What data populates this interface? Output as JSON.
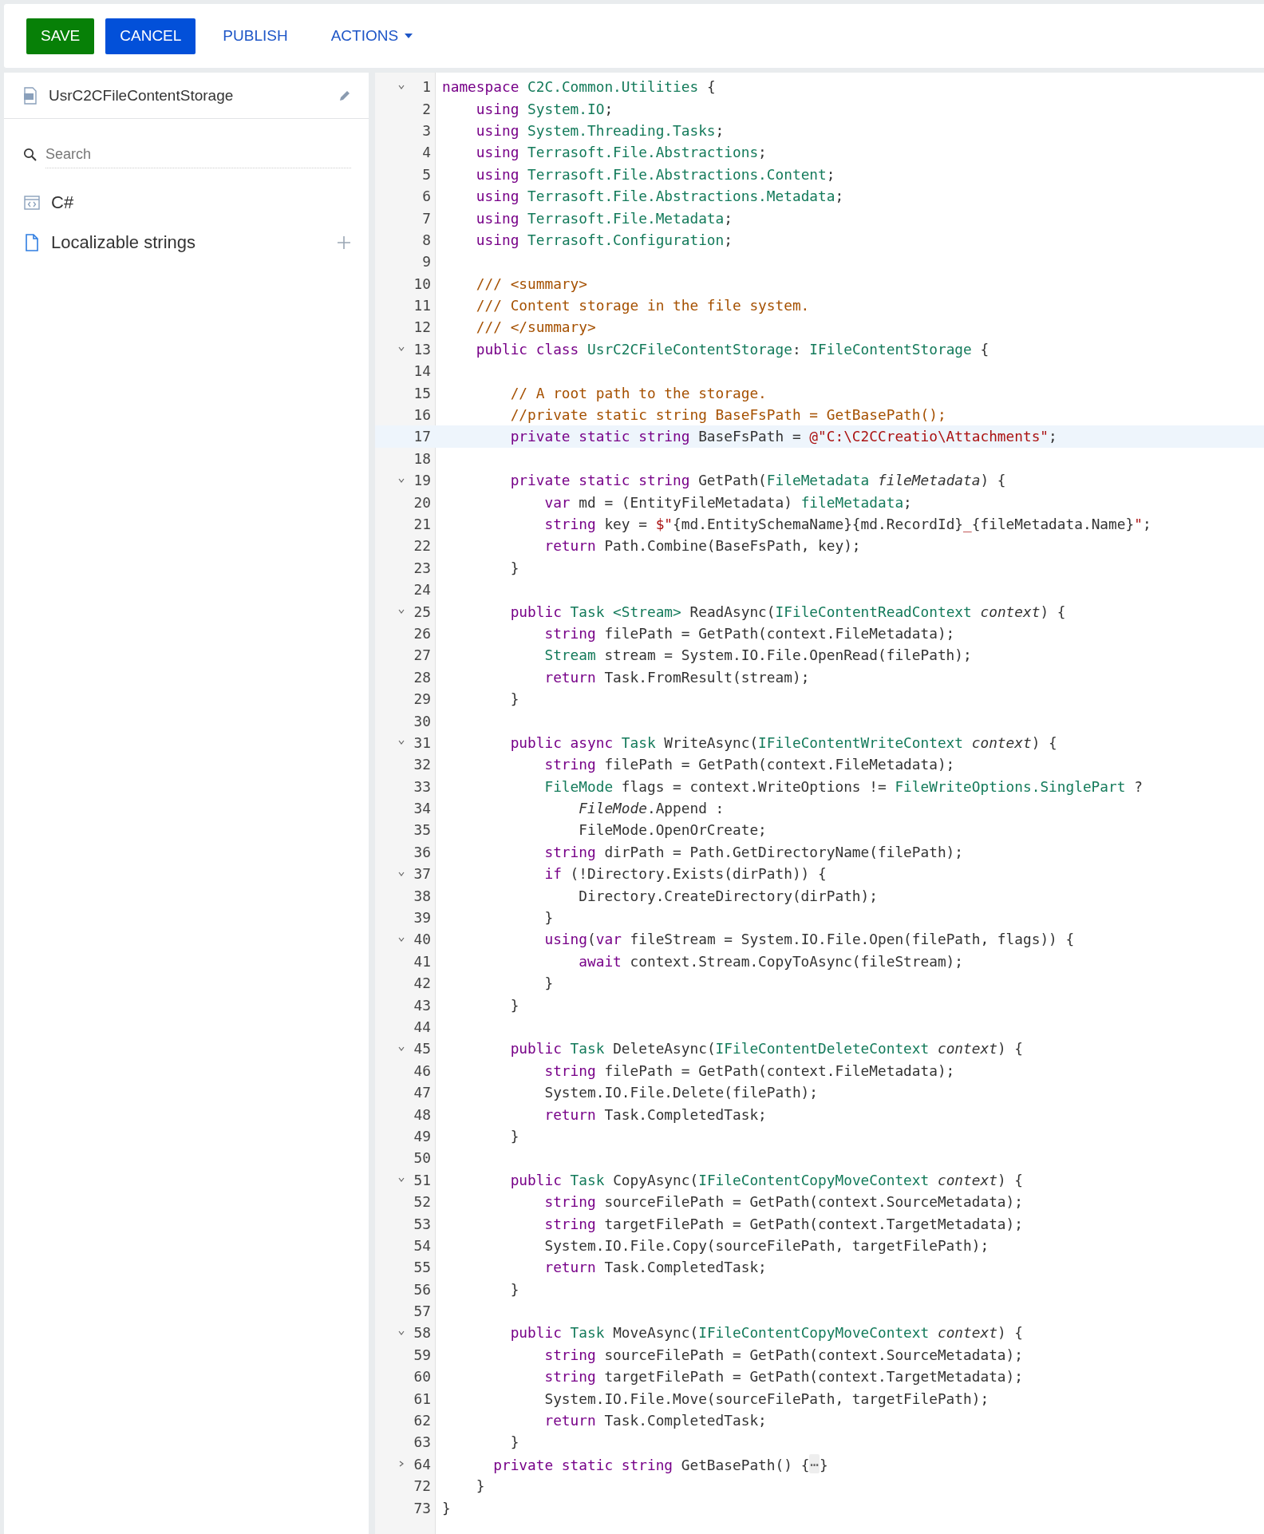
{
  "toolbar": {
    "buttons": [
      {
        "label": "SAVE",
        "kind": "success"
      },
      {
        "label": "CANCEL",
        "kind": "primary"
      },
      {
        "label": "PUBLISH",
        "kind": "link"
      },
      {
        "label": "ACTIONS",
        "kind": "menu"
      }
    ]
  },
  "sidebar": {
    "title": "UsrC2CFileContentStorage",
    "search": {
      "placeholder": "Search"
    },
    "items": [
      {
        "label": "C#",
        "kind": "source"
      },
      {
        "label": "Localizable strings",
        "kind": "strings"
      }
    ]
  },
  "editor": {
    "lines": [
      {
        "number": "1",
        "current": false,
        "expanded": true,
        "tokens": [
          {
            "text": "namespace ",
            "kind": "keyword"
          },
          {
            "text": "C2C.Common.Utilities",
            "kind": "type"
          },
          {
            "text": " {",
            "kind": "plain"
          }
        ]
      },
      {
        "number": "2",
        "current": false,
        "tokens": [
          {
            "text": "    using ",
            "kind": "keyword"
          },
          {
            "text": "System.IO",
            "kind": "type"
          },
          {
            "text": ";",
            "kind": "plain"
          }
        ]
      },
      {
        "number": "3",
        "current": false,
        "tokens": [
          {
            "text": "    using ",
            "kind": "keyword"
          },
          {
            "text": "System.Threading.Tasks",
            "kind": "type"
          },
          {
            "text": ";",
            "kind": "plain"
          }
        ]
      },
      {
        "number": "4",
        "current": false,
        "tokens": [
          {
            "text": "    using ",
            "kind": "keyword"
          },
          {
            "text": "Terrasoft.File.Abstractions",
            "kind": "type"
          },
          {
            "text": ";",
            "kind": "plain"
          }
        ]
      },
      {
        "number": "5",
        "current": false,
        "tokens": [
          {
            "text": "    using ",
            "kind": "keyword"
          },
          {
            "text": "Terrasoft.File.Abstractions.Content",
            "kind": "type"
          },
          {
            "text": ";",
            "kind": "plain"
          }
        ]
      },
      {
        "number": "6",
        "current": false,
        "tokens": [
          {
            "text": "    using ",
            "kind": "keyword"
          },
          {
            "text": "Terrasoft.File.Abstractions.Metadata",
            "kind": "type"
          },
          {
            "text": ";",
            "kind": "plain"
          }
        ]
      },
      {
        "number": "7",
        "current": false,
        "tokens": [
          {
            "text": "    using ",
            "kind": "keyword"
          },
          {
            "text": "Terrasoft.File.Metadata",
            "kind": "type"
          },
          {
            "text": ";",
            "kind": "plain"
          }
        ]
      },
      {
        "number": "8",
        "current": false,
        "tokens": [
          {
            "text": "    using ",
            "kind": "keyword"
          },
          {
            "text": "Terrasoft.Configuration",
            "kind": "type"
          },
          {
            "text": ";",
            "kind": "plain"
          }
        ]
      },
      {
        "number": "9",
        "current": false
      },
      {
        "number": "10",
        "current": false,
        "tokens": [
          {
            "text": "    /// <summary>",
            "kind": "comment"
          }
        ]
      },
      {
        "number": "11",
        "current": false,
        "tokens": [
          {
            "text": "    /// Content storage in the file system.",
            "kind": "comment"
          }
        ]
      },
      {
        "number": "12",
        "current": false,
        "tokens": [
          {
            "text": "    /// </summary>",
            "kind": "comment"
          }
        ]
      },
      {
        "number": "13",
        "current": false,
        "expanded": true,
        "tokens": [
          {
            "text": "    public class ",
            "kind": "keyword"
          },
          {
            "text": "UsrC2CFileContentStorage",
            "kind": "type"
          },
          {
            "text": ": ",
            "kind": "plain"
          },
          {
            "text": "IFileContentStorage",
            "kind": "type"
          },
          {
            "text": " {",
            "kind": "plain"
          }
        ]
      },
      {
        "number": "14",
        "current": false
      },
      {
        "number": "15",
        "current": false,
        "tokens": [
          {
            "text": "        // A root path to the storage.",
            "kind": "comment"
          }
        ]
      },
      {
        "number": "16",
        "current": false,
        "tokens": [
          {
            "text": "        //private static string BaseFsPath = GetBasePath();",
            "kind": "comment"
          }
        ]
      },
      {
        "number": "17",
        "current": true,
        "tokens": [
          {
            "text": "        private static string",
            "kind": "keyword"
          },
          {
            "text": " BaseFsPath = ",
            "kind": "plain"
          },
          {
            "text": "@\"C:\\C2CCreatio\\Attachments\"",
            "kind": "string"
          },
          {
            "text": ";",
            "kind": "plain"
          }
        ]
      },
      {
        "number": "18",
        "current": false
      },
      {
        "number": "19",
        "current": false,
        "expanded": true,
        "tokens": [
          {
            "text": "        private static string",
            "kind": "keyword"
          },
          {
            "text": " GetPath(",
            "kind": "plain"
          },
          {
            "text": "FileMetadata",
            "kind": "type"
          },
          {
            "text": " fileMetadata",
            "kind": "param"
          },
          {
            "text": ") {",
            "kind": "plain"
          }
        ]
      },
      {
        "number": "20",
        "current": false,
        "tokens": [
          {
            "text": "            var",
            "kind": "keyword"
          },
          {
            "text": " md = (EntityFileMetadata) ",
            "kind": "plain"
          },
          {
            "text": "fileMetadata",
            "kind": "type"
          },
          {
            "text": ";",
            "kind": "plain"
          }
        ]
      },
      {
        "number": "21",
        "current": false,
        "tokens": [
          {
            "text": "            string",
            "kind": "keyword"
          },
          {
            "text": " key = ",
            "kind": "plain"
          },
          {
            "text": "$\"",
            "kind": "string"
          },
          {
            "text": "{md.EntitySchemaName}{md.RecordId}",
            "kind": "plain"
          },
          {
            "text": "_",
            "kind": "string"
          },
          {
            "text": "{fileMetadata.Name}",
            "kind": "plain"
          },
          {
            "text": "\"",
            "kind": "string"
          },
          {
            "text": ";",
            "kind": "plain"
          }
        ]
      },
      {
        "number": "22",
        "current": false,
        "tokens": [
          {
            "text": "            return",
            "kind": "keyword"
          },
          {
            "text": " Path.Combine(BaseFsPath, key);",
            "kind": "plain"
          }
        ]
      },
      {
        "number": "23",
        "current": false,
        "tokens": [
          {
            "text": "        }",
            "kind": "plain"
          }
        ]
      },
      {
        "number": "24",
        "current": false
      },
      {
        "number": "25",
        "current": false,
        "expanded": true,
        "tokens": [
          {
            "text": "        public ",
            "kind": "keyword"
          },
          {
            "text": "Task <Stream>",
            "kind": "type"
          },
          {
            "text": " ReadAsync(",
            "kind": "plain"
          },
          {
            "text": "IFileContentReadContext",
            "kind": "type"
          },
          {
            "text": " context",
            "kind": "param"
          },
          {
            "text": ") {",
            "kind": "plain"
          }
        ]
      },
      {
        "number": "26",
        "current": false,
        "tokens": [
          {
            "text": "            string",
            "kind": "keyword"
          },
          {
            "text": " filePath = GetPath(context.FileMetadata);",
            "kind": "plain"
          }
        ]
      },
      {
        "number": "27",
        "current": false,
        "tokens": [
          {
            "text": "            Stream",
            "kind": "type"
          },
          {
            "text": " stream = System.IO.File.OpenRead(filePath);",
            "kind": "plain"
          }
        ]
      },
      {
        "number": "28",
        "current": false,
        "tokens": [
          {
            "text": "            return",
            "kind": "keyword"
          },
          {
            "text": " Task.FromResult(stream);",
            "kind": "plain"
          }
        ]
      },
      {
        "number": "29",
        "current": false,
        "tokens": [
          {
            "text": "        }",
            "kind": "plain"
          }
        ]
      },
      {
        "number": "30",
        "current": false
      },
      {
        "number": "31",
        "current": false,
        "expanded": true,
        "tokens": [
          {
            "text": "        public async ",
            "kind": "keyword"
          },
          {
            "text": "Task",
            "kind": "type"
          },
          {
            "text": " WriteAsync(",
            "kind": "plain"
          },
          {
            "text": "IFileContentWriteContext",
            "kind": "type"
          },
          {
            "text": " context",
            "kind": "param"
          },
          {
            "text": ") {",
            "kind": "plain"
          }
        ]
      },
      {
        "number": "32",
        "current": false,
        "tokens": [
          {
            "text": "            string",
            "kind": "keyword"
          },
          {
            "text": " filePath = GetPath(context.FileMetadata);",
            "kind": "plain"
          }
        ]
      },
      {
        "number": "33",
        "current": false,
        "tokens": [
          {
            "text": "            FileMode",
            "kind": "type"
          },
          {
            "text": " flags = context.WriteOptions != ",
            "kind": "plain"
          },
          {
            "text": "FileWriteOptions.SinglePart",
            "kind": "type"
          },
          {
            "text": " ?",
            "kind": "plain"
          }
        ]
      },
      {
        "number": "34",
        "current": false,
        "tokens": [
          {
            "text": "                FileMode",
            "kind": "param"
          },
          {
            "text": ".Append :",
            "kind": "plain"
          }
        ]
      },
      {
        "number": "35",
        "current": false,
        "tokens": [
          {
            "text": "                FileMode.OpenOrCreate;",
            "kind": "plain"
          }
        ]
      },
      {
        "number": "36",
        "current": false,
        "tokens": [
          {
            "text": "            string",
            "kind": "keyword"
          },
          {
            "text": " dirPath = Path.GetDirectoryName(filePath);",
            "kind": "plain"
          }
        ]
      },
      {
        "number": "37",
        "current": false,
        "expanded": true,
        "tokens": [
          {
            "text": "            if",
            "kind": "keyword"
          },
          {
            "text": " (!Directory.Exists(dirPath)) {",
            "kind": "plain"
          }
        ]
      },
      {
        "number": "38",
        "current": false,
        "tokens": [
          {
            "text": "                Directory.CreateDirectory(dirPath);",
            "kind": "plain"
          }
        ]
      },
      {
        "number": "39",
        "current": false,
        "tokens": [
          {
            "text": "            }",
            "kind": "plain"
          }
        ]
      },
      {
        "number": "40",
        "current": false,
        "expanded": true,
        "tokens": [
          {
            "text": "            using",
            "kind": "keyword"
          },
          {
            "text": "(",
            "kind": "plain"
          },
          {
            "text": "var",
            "kind": "keyword"
          },
          {
            "text": " fileStream = System.IO.File.Open(filePath, flags)) {",
            "kind": "plain"
          }
        ]
      },
      {
        "number": "41",
        "current": false,
        "tokens": [
          {
            "text": "                await",
            "kind": "keyword"
          },
          {
            "text": " context.Stream.CopyToAsync(fileStream);",
            "kind": "plain"
          }
        ]
      },
      {
        "number": "42",
        "current": false,
        "tokens": [
          {
            "text": "            }",
            "kind": "plain"
          }
        ]
      },
      {
        "number": "43",
        "current": false,
        "tokens": [
          {
            "text": "        }",
            "kind": "plain"
          }
        ]
      },
      {
        "number": "44",
        "current": false
      },
      {
        "number": "45",
        "current": false,
        "expanded": true,
        "tokens": [
          {
            "text": "        public ",
            "kind": "keyword"
          },
          {
            "text": "Task",
            "kind": "type"
          },
          {
            "text": " DeleteAsync(",
            "kind": "plain"
          },
          {
            "text": "IFileContentDeleteContext",
            "kind": "type"
          },
          {
            "text": " context",
            "kind": "param"
          },
          {
            "text": ") {",
            "kind": "plain"
          }
        ]
      },
      {
        "number": "46",
        "current": false,
        "tokens": [
          {
            "text": "            string",
            "kind": "keyword"
          },
          {
            "text": " filePath = GetPath(context.FileMetadata);",
            "kind": "plain"
          }
        ]
      },
      {
        "number": "47",
        "current": false,
        "tokens": [
          {
            "text": "            System.IO.File.Delete(filePath);",
            "kind": "plain"
          }
        ]
      },
      {
        "number": "48",
        "current": false,
        "tokens": [
          {
            "text": "            return",
            "kind": "keyword"
          },
          {
            "text": " Task.CompletedTask;",
            "kind": "plain"
          }
        ]
      },
      {
        "number": "49",
        "current": false,
        "tokens": [
          {
            "text": "        }",
            "kind": "plain"
          }
        ]
      },
      {
        "number": "50",
        "current": false
      },
      {
        "number": "51",
        "current": false,
        "expanded": true,
        "tokens": [
          {
            "text": "        public ",
            "kind": "keyword"
          },
          {
            "text": "Task",
            "kind": "type"
          },
          {
            "text": " CopyAsync(",
            "kind": "plain"
          },
          {
            "text": "IFileContentCopyMoveContext",
            "kind": "type"
          },
          {
            "text": " context",
            "kind": "param"
          },
          {
            "text": ") {",
            "kind": "plain"
          }
        ]
      },
      {
        "number": "52",
        "current": false,
        "tokens": [
          {
            "text": "            string",
            "kind": "keyword"
          },
          {
            "text": " sourceFilePath = GetPath(context.SourceMetadata);",
            "kind": "plain"
          }
        ]
      },
      {
        "number": "53",
        "current": false,
        "tokens": [
          {
            "text": "            string",
            "kind": "keyword"
          },
          {
            "text": " targetFilePath = GetPath(context.TargetMetadata);",
            "kind": "plain"
          }
        ]
      },
      {
        "number": "54",
        "current": false,
        "tokens": [
          {
            "text": "            System.IO.File.Copy(sourceFilePath, targetFilePath);",
            "kind": "plain"
          }
        ]
      },
      {
        "number": "55",
        "current": false,
        "tokens": [
          {
            "text": "            return",
            "kind": "keyword"
          },
          {
            "text": " Task.CompletedTask;",
            "kind": "plain"
          }
        ]
      },
      {
        "number": "56",
        "current": false,
        "tokens": [
          {
            "text": "        }",
            "kind": "plain"
          }
        ]
      },
      {
        "number": "57",
        "current": false
      },
      {
        "number": "58",
        "current": false,
        "expanded": true,
        "tokens": [
          {
            "text": "        public ",
            "kind": "keyword"
          },
          {
            "text": "Task",
            "kind": "type"
          },
          {
            "text": " MoveAsync(",
            "kind": "plain"
          },
          {
            "text": "IFileContentCopyMoveContext",
            "kind": "type"
          },
          {
            "text": " context",
            "kind": "param"
          },
          {
            "text": ") {",
            "kind": "plain"
          }
        ]
      },
      {
        "number": "59",
        "current": false,
        "tokens": [
          {
            "text": "            string",
            "kind": "keyword"
          },
          {
            "text": " sourceFilePath = GetPath(context.SourceMetadata);",
            "kind": "plain"
          }
        ]
      },
      {
        "number": "60",
        "current": false,
        "tokens": [
          {
            "text": "            string",
            "kind": "keyword"
          },
          {
            "text": " targetFilePath = GetPath(context.TargetMetadata);",
            "kind": "plain"
          }
        ]
      },
      {
        "number": "61",
        "current": false,
        "tokens": [
          {
            "text": "            System.IO.File.Move(sourceFilePath, targetFilePath);",
            "kind": "plain"
          }
        ]
      },
      {
        "number": "62",
        "current": false,
        "tokens": [
          {
            "text": "            return",
            "kind": "keyword"
          },
          {
            "text": " Task.CompletedTask;",
            "kind": "plain"
          }
        ]
      },
      {
        "number": "63",
        "current": false,
        "tokens": [
          {
            "text": "        }",
            "kind": "plain"
          }
        ]
      },
      {
        "number": "64",
        "current": false,
        "expanded": false,
        "tokens": [
          {
            "text": "      private static string",
            "kind": "keyword"
          },
          {
            "text": " GetBasePath() {",
            "kind": "plain"
          },
          {
            "text": "…",
            "kind": "folded"
          },
          {
            "text": "}",
            "kind": "plain"
          }
        ]
      },
      {
        "number": "72",
        "current": false,
        "tokens": [
          {
            "text": "    }",
            "kind": "plain"
          }
        ]
      },
      {
        "number": "73",
        "current": false,
        "tokens": [
          {
            "text": "}",
            "kind": "plain"
          }
        ]
      }
    ]
  }
}
